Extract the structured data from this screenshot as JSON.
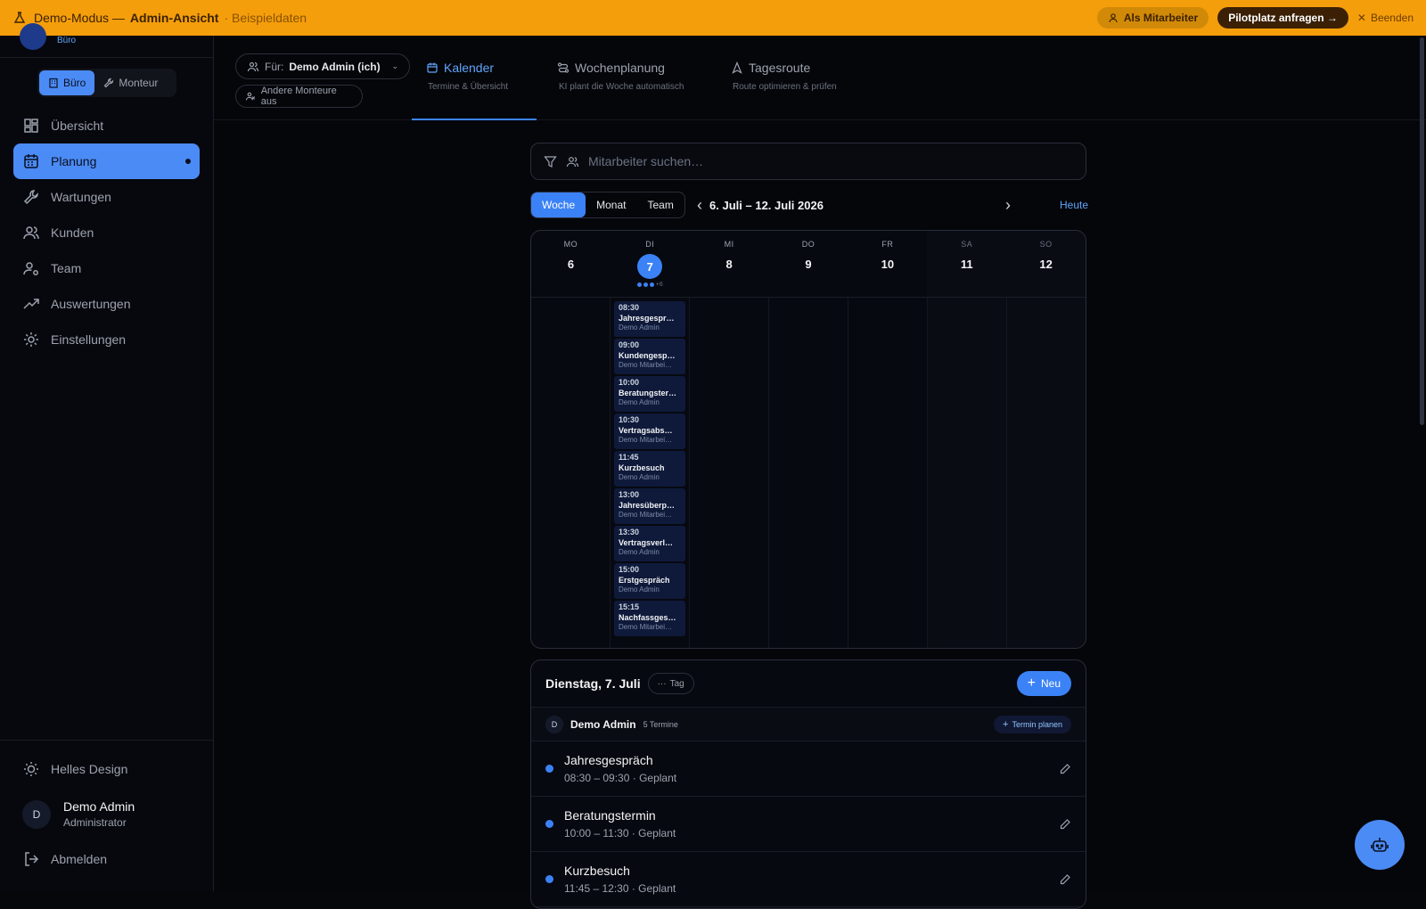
{
  "banner": {
    "mode": "Demo-Modus —",
    "view": "Admin-Ansicht",
    "sample": "· Beispieldaten",
    "as_employee": "Als Mitarbeiter",
    "pilot": "Pilotplatz anfragen →",
    "end": "Beenden"
  },
  "sidebar": {
    "role_top": "Büro",
    "switch": [
      "Büro",
      "Monteur"
    ],
    "items": [
      {
        "label": "Übersicht",
        "icon": "grid-icon"
      },
      {
        "label": "Planung",
        "icon": "calendar-icon",
        "active": true
      },
      {
        "label": "Wartungen",
        "icon": "wrench-icon"
      },
      {
        "label": "Kunden",
        "icon": "users-icon"
      },
      {
        "label": "Team",
        "icon": "team-gear-icon"
      },
      {
        "label": "Auswertungen",
        "icon": "trend-icon"
      },
      {
        "label": "Einstellungen",
        "icon": "gear-icon"
      }
    ],
    "theme": "Helles Design",
    "user": {
      "initial": "D",
      "name": "Demo Admin",
      "role": "Administrator"
    },
    "logout": "Abmelden"
  },
  "topbar": {
    "for_label": "Für:",
    "for_value": "Demo Admin (ich)",
    "others": "Andere Monteure aus",
    "tabs": [
      {
        "label": "Kalender",
        "sub": "Termine & Übersicht"
      },
      {
        "label": "Wochenplanung",
        "sub": "KI plant die Woche automatisch"
      },
      {
        "label": "Tagesroute",
        "sub": "Route optimieren & prüfen"
      }
    ]
  },
  "search": {
    "placeholder": "Mitarbeiter suchen…"
  },
  "calendar": {
    "views": [
      "Woche",
      "Monat",
      "Team"
    ],
    "range": "6. Juli – 12. Juli 2026",
    "today": "Heute",
    "days": [
      {
        "name": "MO",
        "num": "6"
      },
      {
        "name": "DI",
        "num": "7"
      },
      {
        "name": "MI",
        "num": "8"
      },
      {
        "name": "DO",
        "num": "9"
      },
      {
        "name": "FR",
        "num": "10"
      },
      {
        "name": "SA",
        "num": "11"
      },
      {
        "name": "SO",
        "num": "12"
      }
    ],
    "more": "+6",
    "events": [
      {
        "time": "08:30",
        "title": "Jahresgespr…",
        "who": "Demo Admin"
      },
      {
        "time": "09:00",
        "title": "Kundengesp…",
        "who": "Demo Mitarbei…"
      },
      {
        "time": "10:00",
        "title": "Beratungster…",
        "who": "Demo Admin"
      },
      {
        "time": "10:30",
        "title": "Vertragsabs…",
        "who": "Demo Mitarbei…"
      },
      {
        "time": "11:45",
        "title": "Kurzbesuch",
        "who": "Demo Admin"
      },
      {
        "time": "13:00",
        "title": "Jahresüberp…",
        "who": "Demo Mitarbei…"
      },
      {
        "time": "13:30",
        "title": "Vertragsverl…",
        "who": "Demo Admin"
      },
      {
        "time": "15:00",
        "title": "Erstgespräch",
        "who": "Demo Admin"
      },
      {
        "time": "15:15",
        "title": "Nachfassges…",
        "who": "Demo Mitarbei…"
      }
    ]
  },
  "day": {
    "title": "Dienstag, 7. Juli",
    "tag": "Tag",
    "new": "Neu",
    "person": {
      "initial": "D",
      "name": "Demo Admin",
      "count": "5 Termine",
      "plan": "Termin planen"
    },
    "items": [
      {
        "title": "Jahresgespräch",
        "sub": "08:30 – 09:30 · Geplant"
      },
      {
        "title": "Beratungstermin",
        "sub": "10:00 – 11:30 · Geplant"
      },
      {
        "title": "Kurzbesuch",
        "sub": "11:45 – 12:30 · Geplant"
      }
    ]
  },
  "colors": {
    "accent": "#3b82f6",
    "banner": "#f59e0b"
  }
}
